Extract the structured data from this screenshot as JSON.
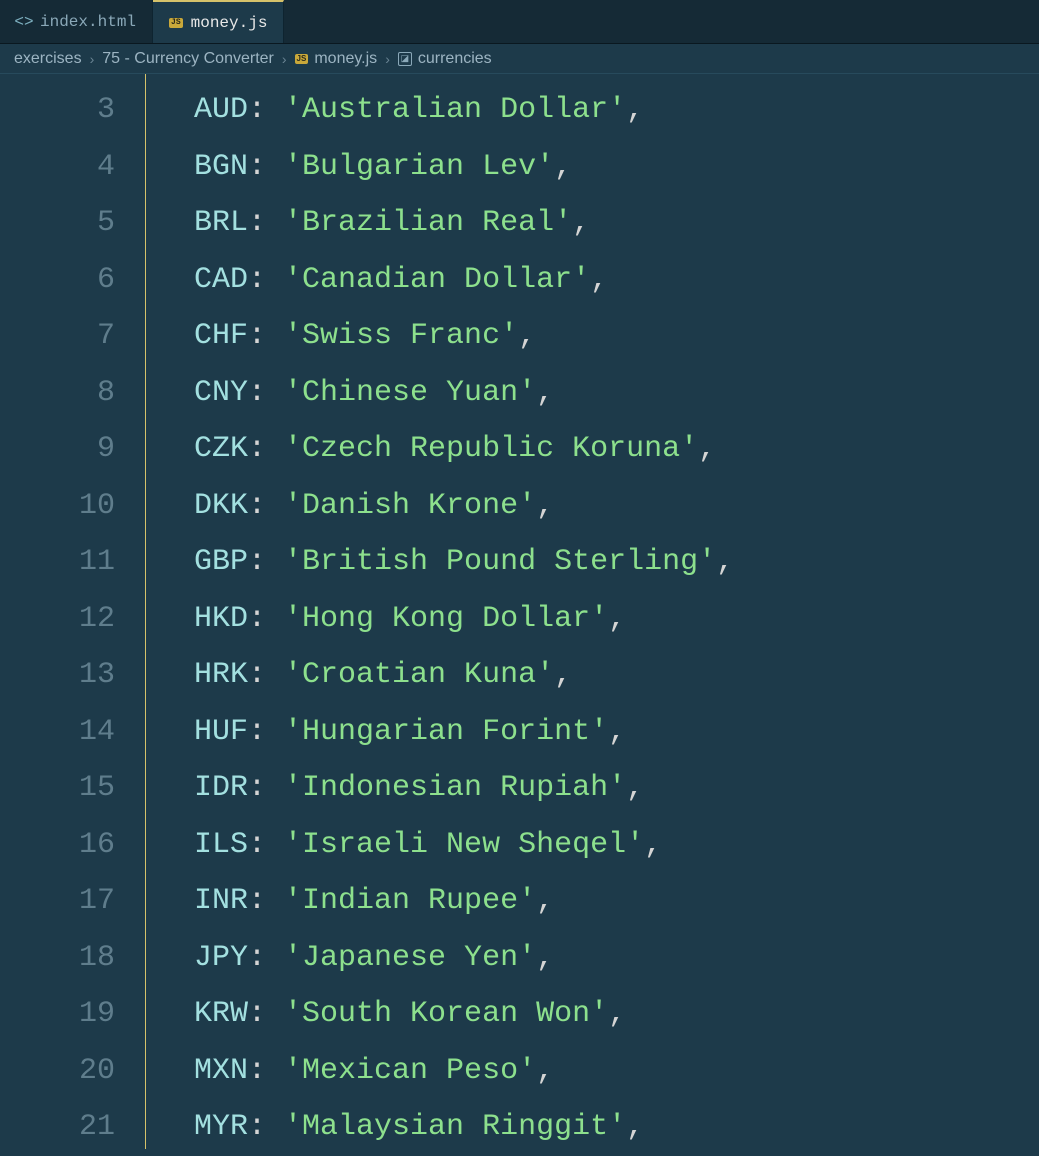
{
  "tabs": [
    {
      "label": "index.html",
      "active": false,
      "iconType": "html"
    },
    {
      "label": "money.js",
      "active": true,
      "iconType": "js"
    }
  ],
  "breadcrumbs": [
    {
      "label": "exercises",
      "icon": null
    },
    {
      "label": "75 - Currency Converter",
      "icon": null
    },
    {
      "label": "money.js",
      "icon": "js"
    },
    {
      "label": "currencies",
      "icon": "symbol"
    }
  ],
  "code": {
    "startLine": 3,
    "lines": [
      {
        "key": "AUD",
        "value": "Australian Dollar"
      },
      {
        "key": "BGN",
        "value": "Bulgarian Lev"
      },
      {
        "key": "BRL",
        "value": "Brazilian Real"
      },
      {
        "key": "CAD",
        "value": "Canadian Dollar"
      },
      {
        "key": "CHF",
        "value": "Swiss Franc"
      },
      {
        "key": "CNY",
        "value": "Chinese Yuan"
      },
      {
        "key": "CZK",
        "value": "Czech Republic Koruna"
      },
      {
        "key": "DKK",
        "value": "Danish Krone"
      },
      {
        "key": "GBP",
        "value": "British Pound Sterling"
      },
      {
        "key": "HKD",
        "value": "Hong Kong Dollar"
      },
      {
        "key": "HRK",
        "value": "Croatian Kuna"
      },
      {
        "key": "HUF",
        "value": "Hungarian Forint"
      },
      {
        "key": "IDR",
        "value": "Indonesian Rupiah"
      },
      {
        "key": "ILS",
        "value": "Israeli New Sheqel"
      },
      {
        "key": "INR",
        "value": "Indian Rupee"
      },
      {
        "key": "JPY",
        "value": "Japanese Yen"
      },
      {
        "key": "KRW",
        "value": "South Korean Won"
      },
      {
        "key": "MXN",
        "value": "Mexican Peso"
      },
      {
        "key": "MYR",
        "value": "Malaysian Ringgit"
      }
    ]
  }
}
